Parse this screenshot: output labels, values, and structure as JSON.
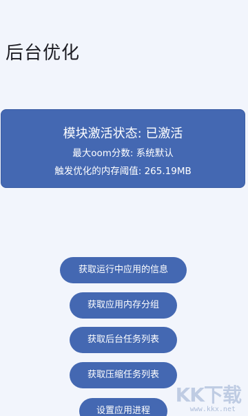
{
  "header": {
    "title": "后台优化"
  },
  "status_card": {
    "activation_status": "模块激活状态: 已激活",
    "max_oom_score": "最大oom分数: 系统默认",
    "memory_threshold": "触发优化的内存阈值: 265.19MB"
  },
  "actions": {
    "get_running_apps": "获取运行中应用的信息",
    "get_memory_groups": "获取应用内存分组",
    "get_background_tasks": "获取后台任务列表",
    "get_compress_tasks": "获取压缩任务列表",
    "set_app_process": "设置应用进程"
  },
  "watermark": {
    "logo": "KK下载",
    "url": "www.kkx.net"
  },
  "colors": {
    "accent": "#4468b2",
    "background": "#f2f5fc",
    "text": "#1c1c22"
  }
}
